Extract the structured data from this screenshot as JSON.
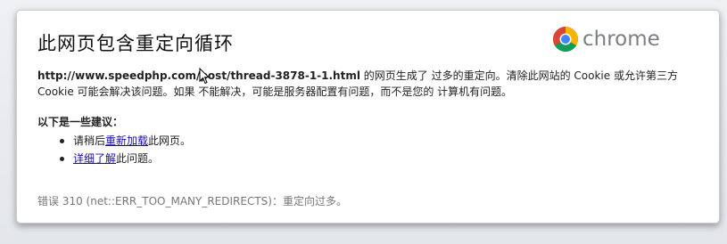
{
  "page": {
    "title": "此网页包含重定向循环",
    "logo_text": "chrome"
  },
  "description": {
    "url": "http://www.speedphp.com/post/thread-3878-1-1.html",
    "text_part1": " 的网页生成了 过多的重定向。清除此网站的 Cookie 或允许第三方 Cookie 可能会解决该问题。如果 不能解决，可能是服务器配置有问题，而不是您的 计算机有问题。"
  },
  "suggestions": {
    "title": "以下是一些建议：",
    "items": [
      {
        "prefix": "请稍后",
        "link": "重新加载",
        "suffix": "此网页。"
      },
      {
        "prefix": "",
        "link": "详细了解",
        "suffix": "此问题。"
      }
    ]
  },
  "error": {
    "text": "错误 310 (net::ERR_TOO_MANY_REDIRECTS)：重定向过多。"
  },
  "colors": {
    "link": "#1a0dab",
    "error_text": "#777777"
  },
  "icons": [
    "chrome-logo-icon",
    "mouse-cursor-icon"
  ]
}
